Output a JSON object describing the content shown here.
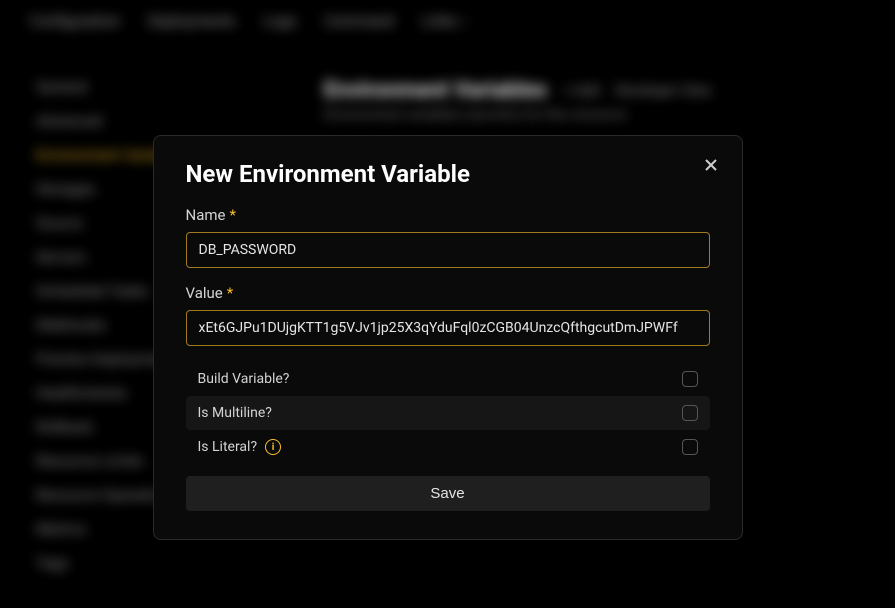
{
  "topTabs": [
    "Configuration",
    "Deployments",
    "Logs",
    "Command",
    "Links ↑"
  ],
  "sidebar": {
    "items": [
      "General",
      "Advanced",
      "Environment Variables",
      "Storages",
      "Source",
      "Servers",
      "Scheduled Tasks",
      "Webhooks",
      "Preview Deployments",
      "Healthchecks",
      "Rollback",
      "Resource Limits",
      "Resource Operations",
      "Metrics",
      "Tags"
    ],
    "activeIndex": 2
  },
  "page": {
    "title": "Environment Variables",
    "addLabel": "+ Add",
    "devViewLabel": "Developer View",
    "subtitle": "Environment variables (secrets) for this resource."
  },
  "modal": {
    "title": "New Environment Variable",
    "nameLabel": "Name",
    "nameValue": "DB_PASSWORD",
    "valueLabel": "Value",
    "valueValue": "xEt6GJPu1DUjgKTT1g5VJv1jp25X3qYduFql0zCGB04UnzcQfthgcutDmJPWFf",
    "buildVarLabel": "Build Variable?",
    "multilineLabel": "Is Multiline?",
    "literalLabel": "Is Literal?",
    "saveLabel": "Save"
  }
}
